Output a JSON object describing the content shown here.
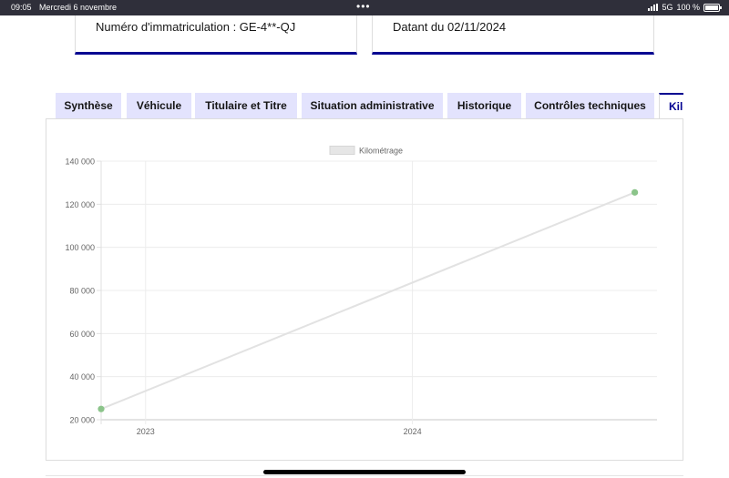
{
  "status_bar": {
    "time": "09:05",
    "date": "Mercredi 6 novembre",
    "dots": "•••",
    "network": "5G",
    "battery": "100 %"
  },
  "cards": [
    {
      "text": "Numéro d'immatriculation : GE-4**-QJ"
    },
    {
      "text": "Datant du 02/11/2024"
    }
  ],
  "tabs": [
    {
      "label": "Synthèse"
    },
    {
      "label": "Véhicule"
    },
    {
      "label": "Titulaire et Titre"
    },
    {
      "label": "Situation administrative"
    },
    {
      "label": "Historique"
    },
    {
      "label": "Contrôles techniques"
    },
    {
      "label": "Kilo",
      "active": true
    }
  ],
  "colors": {
    "accent": "#000091",
    "tab_bg": "#e3e3fd",
    "line": "#e2e2e2",
    "point": "#8bc48a"
  },
  "chart_data": {
    "type": "line",
    "legend": "Kilométrage",
    "legend_position": "top",
    "x_ticks": [
      "2023",
      "2024"
    ],
    "y_ticks": [
      "20 000",
      "40 000",
      "60 000",
      "80 000",
      "100 000",
      "120 000",
      "140 000"
    ],
    "ylim": [
      20000,
      140000
    ],
    "grid": true,
    "series": [
      {
        "name": "Kilométrage",
        "points": [
          {
            "x": "2022-11",
            "y": 25000
          },
          {
            "x": "2024-11",
            "y": 125500
          }
        ]
      }
    ]
  }
}
